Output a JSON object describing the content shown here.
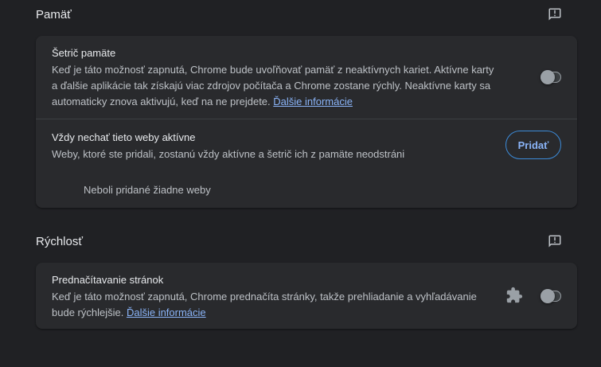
{
  "memory_section": {
    "title": "Pamäť",
    "feedback_icon": "feedback-icon",
    "memory_saver": {
      "title": "Šetrič pamäte",
      "description": "Keď je táto možnosť zapnutá, Chrome bude uvoľňovať pamäť z neaktívnych kariet. Aktívne karty a ďalšie aplikácie tak získajú viac zdrojov počítača a Chrome zostane rýchly. Neaktívne karty sa automaticky znova aktivujú, keď na ne prejdete.",
      "link": "Ďalšie informácie",
      "enabled": false
    },
    "always_active": {
      "title": "Vždy nechať tieto weby aktívne",
      "description": "Weby, ktoré ste pridali, zostanú vždy aktívne a šetrič ich z pamäte neodstráni",
      "add_button": "Pridať",
      "empty_text": "Neboli pridané žiadne weby"
    }
  },
  "speed_section": {
    "title": "Rýchlosť",
    "feedback_icon": "feedback-icon",
    "preload": {
      "title": "Prednačítavanie stránok",
      "description": "Keď je táto možnosť zapnutá, Chrome prednačíta stránky, takže prehliadanie a vyhľadávanie bude rýchlejšie.",
      "link": "Ďalšie informácie",
      "extension_icon": "puzzle-icon",
      "enabled": false
    }
  },
  "colors": {
    "background": "#202124",
    "card": "#292a2d",
    "link": "#8ab4f8",
    "button_border": "#3c8bd9"
  }
}
